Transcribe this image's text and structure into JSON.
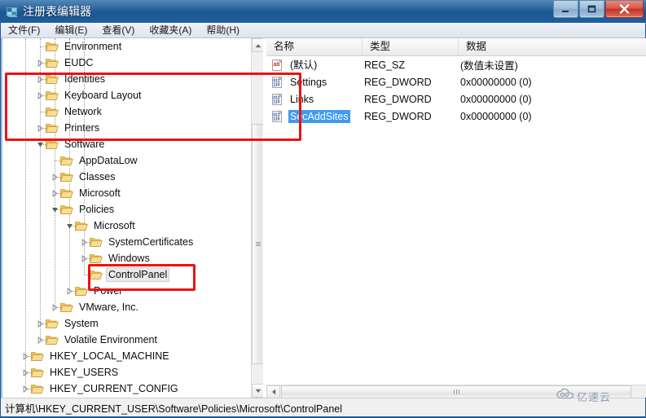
{
  "window": {
    "title": "注册表编辑器",
    "icon": "regedit-icon",
    "controls": {
      "minimize": "minimize-button",
      "maximize": "maximize-button",
      "close": "close-button"
    }
  },
  "menu": {
    "items": [
      {
        "label": "文件(F)",
        "name": "menu-file"
      },
      {
        "label": "编辑(E)",
        "name": "menu-edit"
      },
      {
        "label": "查看(V)",
        "name": "menu-view"
      },
      {
        "label": "收藏夹(A)",
        "name": "menu-favorites"
      },
      {
        "label": "帮助(H)",
        "name": "menu-help"
      }
    ]
  },
  "tree": {
    "nodes": [
      {
        "label": "Environment",
        "depth": 2,
        "twisty": "none",
        "selected": false
      },
      {
        "label": "EUDC",
        "depth": 2,
        "twisty": "collapsed",
        "selected": false
      },
      {
        "label": "Identities",
        "depth": 2,
        "twisty": "collapsed",
        "selected": false
      },
      {
        "label": "Keyboard Layout",
        "depth": 2,
        "twisty": "collapsed",
        "selected": false
      },
      {
        "label": "Network",
        "depth": 2,
        "twisty": "none",
        "selected": false
      },
      {
        "label": "Printers",
        "depth": 2,
        "twisty": "collapsed",
        "selected": false
      },
      {
        "label": "Software",
        "depth": 2,
        "twisty": "expanded",
        "selected": false
      },
      {
        "label": "AppDataLow",
        "depth": 3,
        "twisty": "none",
        "selected": false
      },
      {
        "label": "Classes",
        "depth": 3,
        "twisty": "collapsed",
        "selected": false
      },
      {
        "label": "Microsoft",
        "depth": 3,
        "twisty": "collapsed",
        "selected": false
      },
      {
        "label": "Policies",
        "depth": 3,
        "twisty": "expanded",
        "selected": false
      },
      {
        "label": "Microsoft",
        "depth": 4,
        "twisty": "expanded",
        "selected": false
      },
      {
        "label": "SystemCertificates",
        "depth": 5,
        "twisty": "collapsed",
        "selected": false
      },
      {
        "label": "Windows",
        "depth": 5,
        "twisty": "collapsed",
        "selected": false
      },
      {
        "label": "ControlPanel",
        "depth": 5,
        "twisty": "none",
        "selected": true
      },
      {
        "label": "Power",
        "depth": 4,
        "twisty": "collapsed",
        "selected": false
      },
      {
        "label": "VMware, Inc.",
        "depth": 3,
        "twisty": "collapsed",
        "selected": false
      },
      {
        "label": "System",
        "depth": 2,
        "twisty": "collapsed",
        "selected": false
      },
      {
        "label": "Volatile Environment",
        "depth": 2,
        "twisty": "collapsed",
        "selected": false
      },
      {
        "label": "HKEY_LOCAL_MACHINE",
        "depth": 1,
        "twisty": "collapsed",
        "selected": false
      },
      {
        "label": "HKEY_USERS",
        "depth": 1,
        "twisty": "collapsed",
        "selected": false
      },
      {
        "label": "HKEY_CURRENT_CONFIG",
        "depth": 1,
        "twisty": "collapsed",
        "selected": false
      }
    ]
  },
  "list": {
    "columns": [
      {
        "label": "名称",
        "name": "column-name"
      },
      {
        "label": "类型",
        "name": "column-type"
      },
      {
        "label": "数据",
        "name": "column-data"
      }
    ],
    "rows": [
      {
        "name": "(默认)",
        "type": "REG_SZ",
        "data": "(数值未设置)",
        "icon": "string-value-icon",
        "selected": false
      },
      {
        "name": "Settings",
        "type": "REG_DWORD",
        "data": "0x00000000 (0)",
        "icon": "dword-value-icon",
        "selected": false
      },
      {
        "name": "Links",
        "type": "REG_DWORD",
        "data": "0x00000000 (0)",
        "icon": "dword-value-icon",
        "selected": false
      },
      {
        "name": "SecAddSites",
        "type": "REG_DWORD",
        "data": "0x00000000 (0)",
        "icon": "dword-value-icon",
        "selected": true
      }
    ]
  },
  "annotations": {
    "accent_color": "#ee1111",
    "highlight_tree_node": "ControlPanel",
    "highlight_values": [
      "Settings",
      "Links",
      "SecAddSites"
    ]
  },
  "statusbar": {
    "path": "计算机\\HKEY_CURRENT_USER\\Software\\Policies\\Microsoft\\ControlPanel"
  },
  "watermark": {
    "text": "亿速云",
    "icon": "cloud-logo-icon"
  },
  "colors": {
    "title_bar": "#225e97",
    "selection_blue": "#3e9bf0",
    "folder_yellow": "#fcd77f",
    "annotation_red": "#ee1111"
  }
}
